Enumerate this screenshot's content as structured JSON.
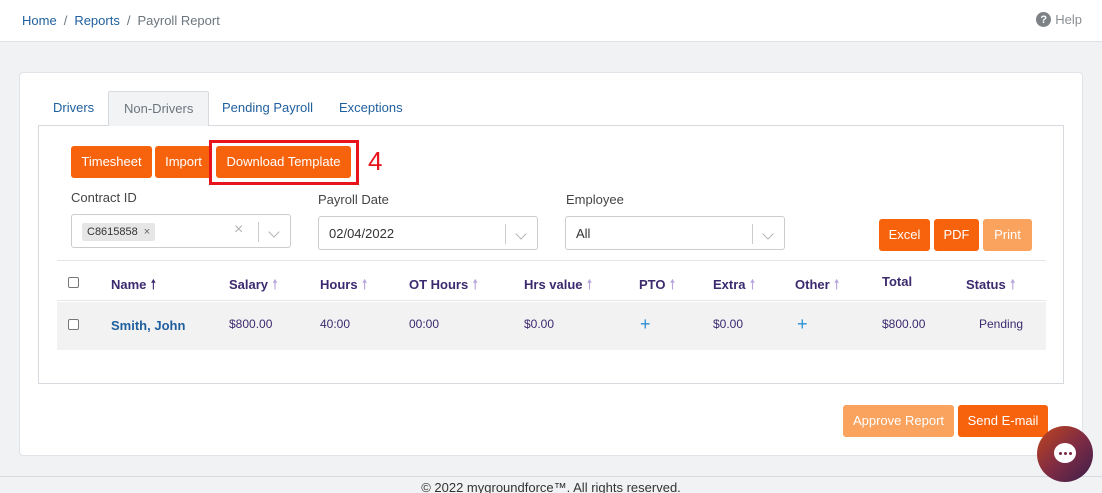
{
  "breadcrumb": {
    "home": "Home",
    "reports": "Reports",
    "current": "Payroll Report",
    "separator": "/"
  },
  "help": {
    "icon": "question-circle-icon",
    "label": "Help"
  },
  "tabs": [
    {
      "label": "Drivers",
      "active": false
    },
    {
      "label": "Non-Drivers",
      "active": true
    },
    {
      "label": "Pending Payroll",
      "active": false
    },
    {
      "label": "Exceptions",
      "active": false
    }
  ],
  "toolbar": {
    "timesheet": "Timesheet",
    "import": "Import",
    "download_template": "Download Template"
  },
  "annotation": {
    "step": "4",
    "color": "#e8141c"
  },
  "filters": {
    "contract": {
      "label": "Contract ID",
      "chip": "C8615858",
      "chip_remove": "×",
      "clear": "×"
    },
    "payroll_date": {
      "label": "Payroll Date",
      "value": "02/04/2022"
    },
    "employee": {
      "label": "Employee",
      "value": "All"
    }
  },
  "export": {
    "excel": "Excel",
    "pdf": "PDF",
    "print": "Print"
  },
  "table": {
    "columns": [
      "Name",
      "Salary",
      "Hours",
      "OT Hours",
      "Hrs value",
      "PTO",
      "Extra",
      "Other",
      "Total",
      "Status"
    ],
    "sort_arrow": "🠕",
    "rows": [
      {
        "name": "Smith, John",
        "salary": "$800.00",
        "hours": "40:00",
        "ot_hours": "00:00",
        "hrs_value": "$0.00",
        "pto": "+",
        "extra": "$0.00",
        "other": "+",
        "total": "$800.00",
        "status": "Pending"
      }
    ]
  },
  "actions": {
    "approve": "Approve Report",
    "send_email": "Send E-mail"
  },
  "footer": {
    "copyright": "© 2022 mygroundforce™. All rights reserved."
  },
  "colors": {
    "accent": "#f7630c",
    "accent_light": "#f9a35f",
    "link": "#1f5f9e",
    "header_text": "#3c2a6e"
  }
}
